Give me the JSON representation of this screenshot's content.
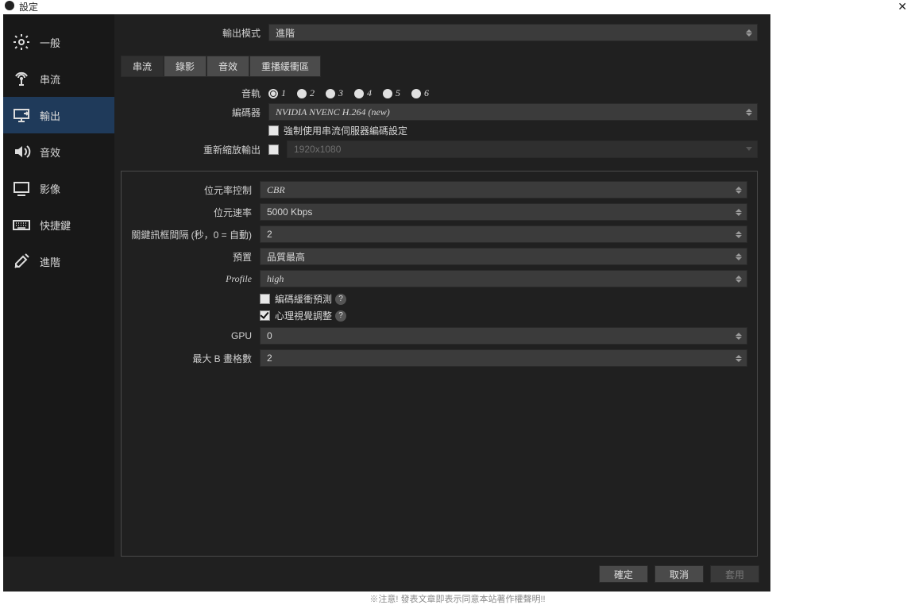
{
  "window": {
    "title": "設定"
  },
  "sidebar": {
    "items": [
      {
        "label": "一般"
      },
      {
        "label": "串流"
      },
      {
        "label": "輸出"
      },
      {
        "label": "音效"
      },
      {
        "label": "影像"
      },
      {
        "label": "快捷鍵"
      },
      {
        "label": "進階"
      }
    ],
    "active_index": 2
  },
  "output": {
    "mode_label": "輸出模式",
    "mode_value": "進階",
    "tabs": [
      {
        "label": "串流"
      },
      {
        "label": "錄影"
      },
      {
        "label": "音效"
      },
      {
        "label": "重播緩衝區"
      }
    ],
    "active_tab": 0,
    "audio_track_label": "音軌",
    "audio_tracks": [
      "1",
      "2",
      "3",
      "4",
      "5",
      "6"
    ],
    "audio_track_selected": 0,
    "encoder_label": "編碼器",
    "encoder_value": "NVIDIA NVENC H.264 (new)",
    "enforce_label": "強制使用串流伺服器編碼設定",
    "enforce_checked": false,
    "rescale_label": "重新縮放輸出",
    "rescale_checked": false,
    "rescale_value": "1920x1080"
  },
  "encoder_settings": {
    "rate_control_label": "位元率控制",
    "rate_control_value": "CBR",
    "bitrate_label": "位元速率",
    "bitrate_value": "5000 Kbps",
    "keyframe_label": "關鍵訊框間隔 (秒，0 = 自動)",
    "keyframe_value": "2",
    "preset_label": "預置",
    "preset_value": "品質最高",
    "profile_label": "Profile",
    "profile_value": "high",
    "lookahead_label": "編碼緩衝預測",
    "lookahead_checked": false,
    "psycho_label": "心理視覺調整",
    "psycho_checked": true,
    "gpu_label": "GPU",
    "gpu_value": "0",
    "bframes_label": "最大 B 畫格數",
    "bframes_value": "2"
  },
  "footer": {
    "ok": "確定",
    "cancel": "取消",
    "apply": "套用"
  },
  "watermark": "※注意! 發表文章即表示同意本站著作權聲明!!"
}
